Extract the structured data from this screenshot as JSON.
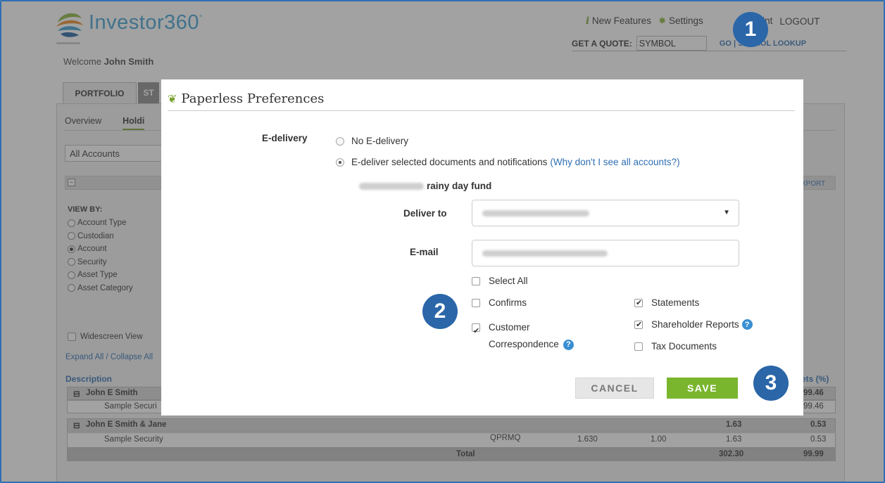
{
  "brand": {
    "name": "Investor360°",
    "name_main": "Investor360",
    "name_suffix": "°"
  },
  "header": {
    "welcome_prefix": "Welcome",
    "user_name": "John Smith",
    "new_features": "New Features",
    "settings": "Settings",
    "print": "Print",
    "logout": "LOGOUT",
    "quote_label": "GET A QUOTE:",
    "quote_value": "SYMBOL",
    "go": "GO",
    "symbol_lookup": "SYMBOL LOOKUP"
  },
  "tabs": [
    {
      "label": "PORTFOLIO"
    },
    {
      "label": "ST"
    }
  ],
  "subnav": [
    {
      "label": "Overview"
    },
    {
      "label": "Holdi"
    }
  ],
  "accounts_select": "All Accounts",
  "export": "XPORT",
  "view_by": {
    "title": "VIEW BY:",
    "options": [
      "Account Type",
      "Custodian",
      "Account",
      "Security",
      "Asset Type",
      "Asset Category"
    ],
    "selected": "Account"
  },
  "widescreen": "Widescreen View",
  "expand_collapse": "Expand All / Collapse All",
  "table": {
    "col_description": "Description",
    "col_pct": "ets (%)",
    "rows": [
      {
        "desc": "John E Smith",
        "v1": "",
        "v2": "99.46"
      },
      {
        "desc": "Sample Securi",
        "v1": "",
        "v2": "99.46"
      },
      {
        "desc": "John E Smith & Jane",
        "v1": "1.63",
        "v2": "0.53"
      },
      {
        "desc": "Sample Security",
        "symbol": "QPRMQ",
        "qty": "1.630",
        "price": "1.00",
        "v1": "1.63",
        "v2": "0.53"
      }
    ],
    "total": {
      "label": "Total",
      "v1": "302.30",
      "v2": "99.99"
    }
  },
  "modal": {
    "title": "Paperless Preferences",
    "edelivery_label": "E-delivery",
    "opt_none": "No E-delivery",
    "opt_selected": "E-deliver selected documents and notifications",
    "why_link": "(Why don't I see all accounts?)",
    "account_suffix": "rainy day fund",
    "deliver_to_label": "Deliver to",
    "email_label": "E-mail",
    "select_all": "Select All",
    "confirms": "Confirms",
    "customer_corr_1": "Customer",
    "customer_corr_2": "Correspondence",
    "statements": "Statements",
    "shareholder_reports": "Shareholder Reports",
    "tax_documents": "Tax Documents",
    "help_glyph": "?",
    "cancel": "CANCEL",
    "save": "SAVE",
    "checks": {
      "select_all": false,
      "confirms": false,
      "customer_correspondence": true,
      "statements": true,
      "shareholder_reports": true,
      "tax_documents": false
    }
  },
  "markers": [
    "1",
    "2",
    "3"
  ],
  "colors": {
    "accent_blue": "#2f6fb3",
    "save_green": "#7ab52e",
    "marker_blue": "#2a66a8"
  }
}
